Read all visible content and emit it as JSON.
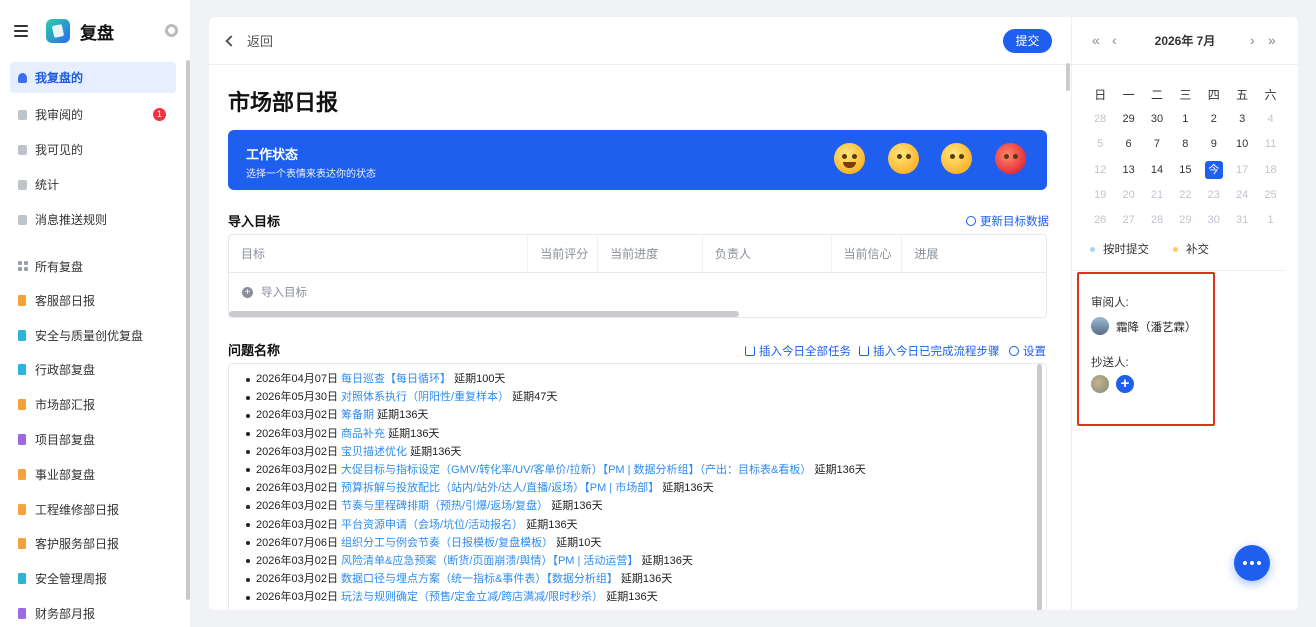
{
  "app": {
    "title": "复盘"
  },
  "sidebar": {
    "items": [
      {
        "label": "我复盘的",
        "active": true
      },
      {
        "label": "我审阅的",
        "badge": "1"
      },
      {
        "label": "我可见的"
      },
      {
        "label": "统计"
      },
      {
        "label": "消息推送规则"
      }
    ],
    "section_title": "所有复盘",
    "reports": [
      {
        "label": "客服部日报",
        "color": "#f4a23b"
      },
      {
        "label": "安全与质量创优复盘",
        "color": "#2bb6d8"
      },
      {
        "label": "行政部复盘",
        "color": "#2bb6d8"
      },
      {
        "label": "市场部汇报",
        "color": "#f4a23b"
      },
      {
        "label": "项目部复盘",
        "color": "#9c6ade"
      },
      {
        "label": "事业部复盘",
        "color": "#f4a23b"
      },
      {
        "label": "工程维修部日报",
        "color": "#f4a23b"
      },
      {
        "label": "客护服务部日报",
        "color": "#f4a23b"
      },
      {
        "label": "安全管理周报",
        "color": "#2bb6d8"
      },
      {
        "label": "财务部月报",
        "color": "#9c6ade"
      }
    ]
  },
  "main": {
    "back_label": "返回",
    "submit_label": "提交",
    "page_title": "市场部日报",
    "status": {
      "title": "工作状态",
      "subtitle": "选择一个表情来表达你的状态"
    },
    "goals": {
      "title": "导入目标",
      "refresh_label": "更新目标数据",
      "columns": [
        "目标",
        "当前评分",
        "当前进度",
        "负责人",
        "当前信心",
        "进展"
      ],
      "import_label": "导入目标"
    },
    "issues": {
      "title": "问题名称",
      "insert_all_label": "插入今日全部任务",
      "insert_done_label": "插入今日已完成流程步骤",
      "settings_label": "设置",
      "rows": [
        {
          "date": "2026年04月07日",
          "link": "每日巡查【每日循环】",
          "delay": "延期100天"
        },
        {
          "date": "2026年05月30日",
          "link": "对照体系执行（阴阳性/重复样本）",
          "delay": "延期47天"
        },
        {
          "date": "2026年03月02日",
          "link": "筹备期",
          "delay": "延期136天"
        },
        {
          "date": "2026年03月02日",
          "link": "商品补充",
          "delay": "延期136天"
        },
        {
          "date": "2026年03月02日",
          "link": "宝贝描述优化",
          "delay": "延期136天"
        },
        {
          "date": "2026年03月02日",
          "link": "大促目标与指标设定（GMV/转化率/UV/客单价/拉新）【PM | 数据分析组】（产出：目标表&看板）",
          "delay": "延期136天"
        },
        {
          "date": "2026年03月02日",
          "link": "预算拆解与投放配比（站内/站外/达人/直播/返场）【PM | 市场部】",
          "delay": "延期136天"
        },
        {
          "date": "2026年03月02日",
          "link": "节奏与里程碑排期（预热/引爆/返场/复盘）",
          "delay": "延期136天"
        },
        {
          "date": "2026年03月02日",
          "link": "平台资源申请（会场/坑位/活动报名）",
          "delay": "延期136天"
        },
        {
          "date": "2026年07月06日",
          "link": "组织分工与例会节奏（日报模板/复盘模板）",
          "delay": "延期10天"
        },
        {
          "date": "2026年03月02日",
          "link": "风险清单&应急预案（断货/页面崩溃/舆情）【PM | 活动运营】",
          "delay": "延期136天"
        },
        {
          "date": "2026年03月02日",
          "link": "数据口径与埋点方案（统一指标&事件表）【数据分析组】",
          "delay": "延期136天"
        },
        {
          "date": "2026年03月02日",
          "link": "玩法与规则确定（预售/定金立减/跨店满减/限时秒杀）",
          "delay": "延期136天"
        }
      ]
    }
  },
  "calendar": {
    "month_label": "2026年 7月",
    "weekdays": [
      "日",
      "一",
      "二",
      "三",
      "四",
      "五",
      "六"
    ],
    "weeks": [
      [
        {
          "d": "28",
          "m": true
        },
        {
          "d": "29"
        },
        {
          "d": "30"
        },
        {
          "d": "1"
        },
        {
          "d": "2"
        },
        {
          "d": "3"
        },
        {
          "d": "4",
          "m": true
        }
      ],
      [
        {
          "d": "5",
          "m": true
        },
        {
          "d": "6"
        },
        {
          "d": "7"
        },
        {
          "d": "8"
        },
        {
          "d": "9"
        },
        {
          "d": "10"
        },
        {
          "d": "11",
          "m": true
        }
      ],
      [
        {
          "d": "12",
          "m": true
        },
        {
          "d": "13"
        },
        {
          "d": "14"
        },
        {
          "d": "15"
        },
        {
          "d": "今",
          "today": true
        },
        {
          "d": "17",
          "m": true
        },
        {
          "d": "18",
          "m": true
        }
      ],
      [
        {
          "d": "19",
          "m": true
        },
        {
          "d": "20",
          "m": true
        },
        {
          "d": "21",
          "m": true
        },
        {
          "d": "22",
          "m": true
        },
        {
          "d": "23",
          "m": true
        },
        {
          "d": "24",
          "m": true
        },
        {
          "d": "25",
          "m": true
        }
      ],
      [
        {
          "d": "26",
          "m": true
        },
        {
          "d": "27",
          "m": true
        },
        {
          "d": "28",
          "m": true
        },
        {
          "d": "29",
          "m": true
        },
        {
          "d": "30",
          "m": true
        },
        {
          "d": "31",
          "m": true
        },
        {
          "d": "1",
          "m": true
        }
      ]
    ],
    "legend": [
      {
        "label": "按时提交",
        "color": "#a9d5f5"
      },
      {
        "label": "补交",
        "color": "#f6cf6a"
      }
    ]
  },
  "reviewers": {
    "reviewer_label": "审阅人:",
    "reviewer_name": "霜降（潘艺霖）",
    "cc_label": "抄送人:"
  }
}
